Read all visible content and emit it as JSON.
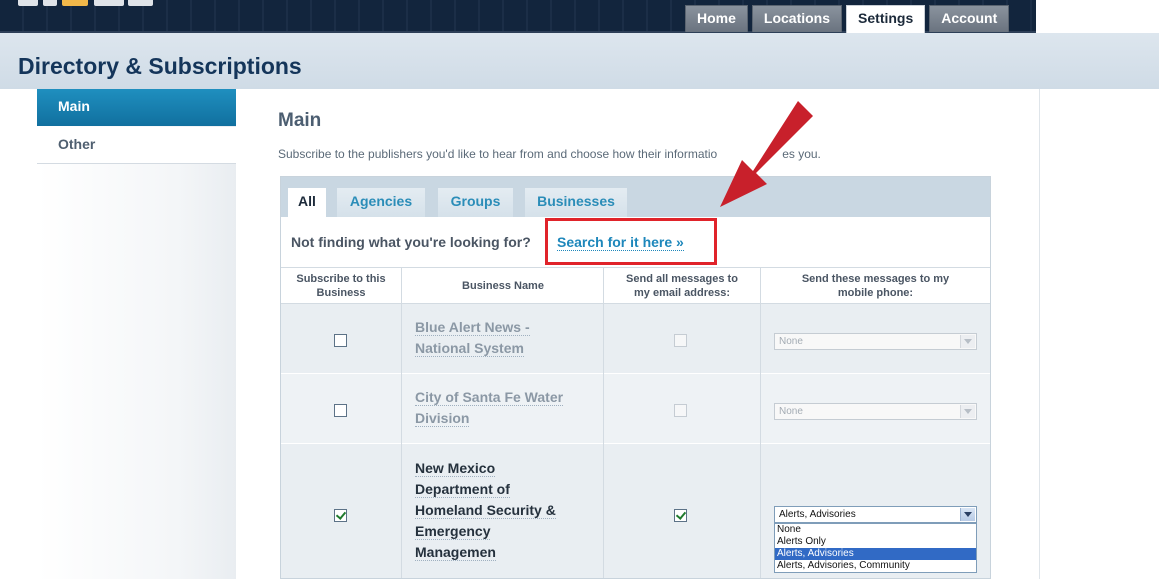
{
  "top_nav": {
    "tabs": [
      {
        "label": "Home",
        "active": false
      },
      {
        "label": "Locations",
        "active": false
      },
      {
        "label": "Settings",
        "active": true
      },
      {
        "label": "Account",
        "active": false
      }
    ]
  },
  "page_title": "Directory & Subscriptions",
  "sidebar": {
    "items": [
      {
        "label": "Main",
        "active": true
      },
      {
        "label": "Other",
        "active": false
      }
    ]
  },
  "main": {
    "title": "Main",
    "intro_left": "Subscribe to the publishers you'd like to hear from and choose how their informatio",
    "intro_right": "es you.",
    "tabs": [
      {
        "label": "All",
        "active": true
      },
      {
        "label": "Agencies",
        "active": false
      },
      {
        "label": "Groups",
        "active": false
      },
      {
        "label": "Businesses",
        "active": false
      }
    ],
    "not_finding": "Not finding what you're looking for?",
    "search_link": "Search for it here »",
    "table": {
      "headers": [
        "Subscribe to this Business",
        "Business Name",
        "Send all messages to my email address:",
        "Send these messages to my mobile phone:"
      ],
      "rows": [
        {
          "name_lines": [
            "Blue Alert News -",
            "National System"
          ],
          "subscribed": false,
          "email": false,
          "mobile": "None",
          "enabled": false
        },
        {
          "name_lines": [
            "City of Santa Fe Water",
            "Division"
          ],
          "subscribed": false,
          "email": false,
          "mobile": "None",
          "enabled": false
        },
        {
          "name_lines": [
            "New Mexico",
            "Department of",
            "Homeland Security &",
            "Emergency",
            "Managemen"
          ],
          "subscribed": true,
          "email": true,
          "mobile": "Alerts, Advisories",
          "enabled": true
        }
      ],
      "mobile_options": [
        "None",
        "Alerts Only",
        "Alerts, Advisories",
        "Alerts, Advisories, Community"
      ]
    }
  },
  "colors": {
    "annotation_red": "#e0232a",
    "link_blue": "#1e87bb",
    "sidebar_active": "#1f8fbf"
  }
}
